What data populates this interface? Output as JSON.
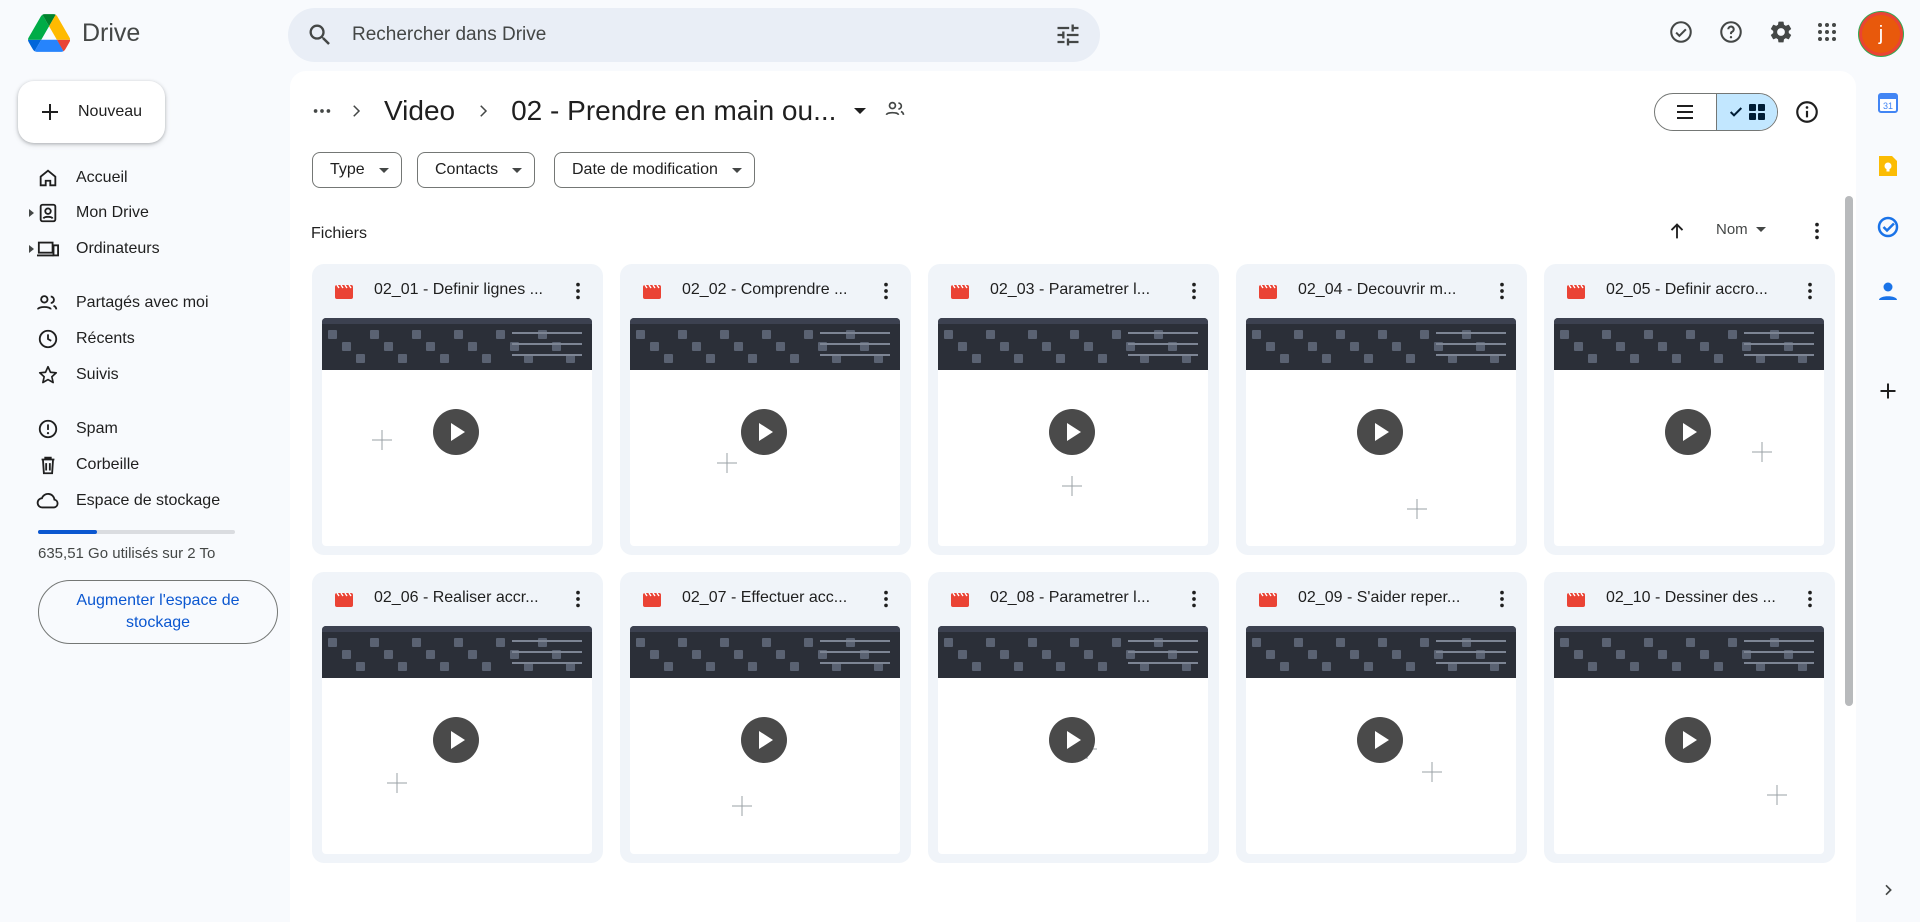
{
  "app": {
    "name": "Drive"
  },
  "search": {
    "placeholder": "Rechercher dans Drive"
  },
  "sidebar": {
    "new_label": "Nouveau",
    "items": [
      {
        "label": "Accueil",
        "icon": "home-icon"
      },
      {
        "label": "Mon Drive",
        "icon": "my-drive-icon",
        "expandable": true
      },
      {
        "label": "Ordinateurs",
        "icon": "computers-icon",
        "expandable": true
      },
      {
        "label": "Partagés avec moi",
        "icon": "shared-icon"
      },
      {
        "label": "Récents",
        "icon": "clock-icon"
      },
      {
        "label": "Suivis",
        "icon": "star-icon"
      },
      {
        "label": "Spam",
        "icon": "spam-icon"
      },
      {
        "label": "Corbeille",
        "icon": "trash-icon"
      },
      {
        "label": "Espace de stockage",
        "icon": "cloud-icon"
      }
    ],
    "storage": {
      "used_text": "635,51 Go utilisés sur 2 To",
      "fraction_used": 0.32
    },
    "upgrade_label": "Augmenter l'espace de stockage"
  },
  "header": {
    "avatar_letter": "j"
  },
  "breadcrumb": {
    "items": [
      "Video",
      "02 - Prendre en main ou..."
    ]
  },
  "filters": [
    "Type",
    "Contacts",
    "Date de modification"
  ],
  "files_section": {
    "title": "Fichiers",
    "sort_label": "Nom"
  },
  "files": [
    {
      "name": "02_01 - Definir lignes ..."
    },
    {
      "name": "02_02 - Comprendre ..."
    },
    {
      "name": "02_03 - Parametrer l..."
    },
    {
      "name": "02_04 - Decouvrir m..."
    },
    {
      "name": "02_05 - Definir accro..."
    },
    {
      "name": "02_06 - Realiser accr..."
    },
    {
      "name": "02_07 - Effectuer acc..."
    },
    {
      "name": "02_08 - Parametrer l..."
    },
    {
      "name": "02_09 - S'aider reper..."
    },
    {
      "name": "02_10 - Dessiner des ..."
    }
  ],
  "colors": {
    "accent": "#0b57d0",
    "video_icon": "#ea4335",
    "search_bg": "#e9eef6",
    "selected_toggle": "#c2e7ff"
  }
}
